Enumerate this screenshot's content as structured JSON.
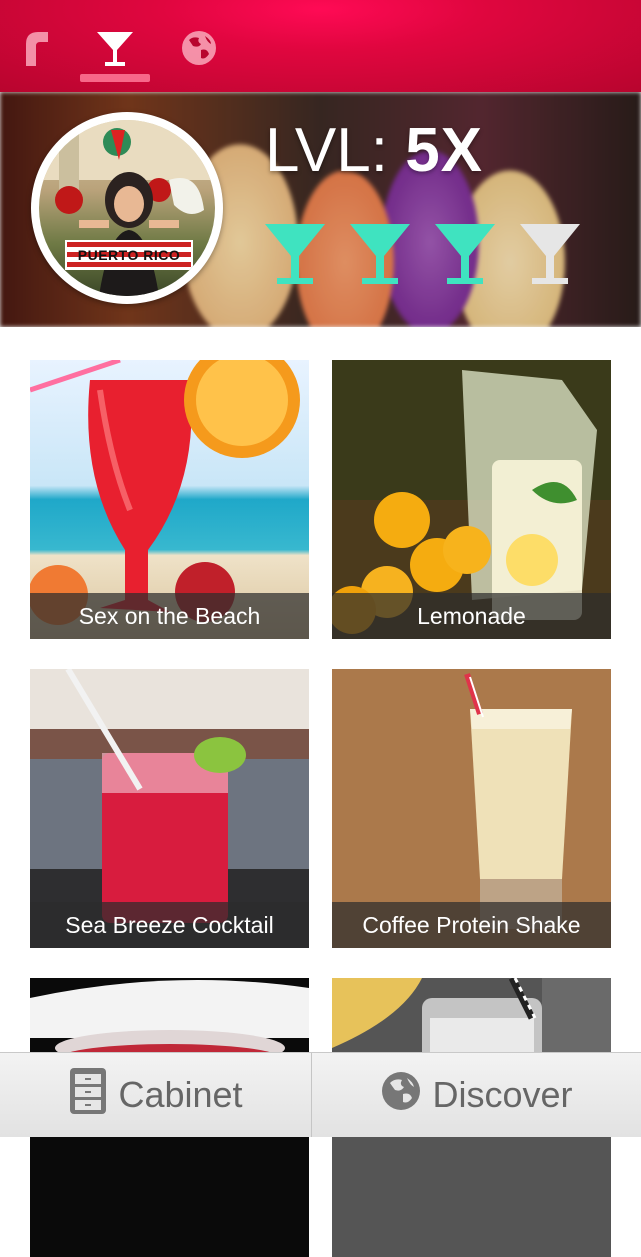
{
  "nav": {
    "items": [
      {
        "icon": "app-logo-icon"
      },
      {
        "icon": "cocktail-icon",
        "active": true
      },
      {
        "icon": "globe-icon"
      }
    ]
  },
  "profile": {
    "avatar_sign": "PUERTO RICO",
    "level_label": "LVL:",
    "level_value": "5X",
    "glasses_filled": 3,
    "glasses_total": 4
  },
  "drinks": [
    {
      "name": "Sex on the Beach"
    },
    {
      "name": "Lemonade"
    },
    {
      "name": "Sea Breeze Cocktail"
    },
    {
      "name": "Coffee Protein Shake"
    },
    {
      "name": ""
    },
    {
      "name": ""
    }
  ],
  "tabs": [
    {
      "label": "Cabinet",
      "icon": "cabinet-icon"
    },
    {
      "label": "Discover",
      "icon": "globe-icon"
    }
  ],
  "colors": {
    "accent": "#e0063f",
    "glass_filled": "#3fe3c0",
    "glass_empty": "#e6e6e6"
  }
}
